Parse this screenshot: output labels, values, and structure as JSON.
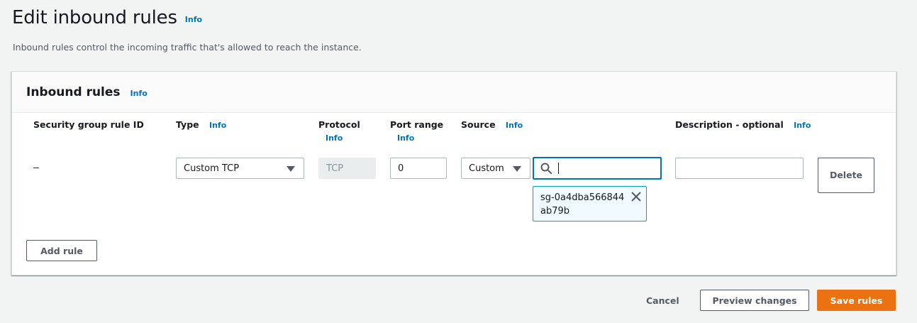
{
  "page": {
    "title": "Edit inbound rules",
    "title_info": "Info",
    "subtitle": "Inbound rules control the incoming traffic that's allowed to reach the instance."
  },
  "panel": {
    "title": "Inbound rules",
    "title_info": "Info",
    "columns": {
      "rule_id": "Security group rule ID",
      "type": "Type",
      "type_info": "Info",
      "protocol": "Protocol",
      "protocol_info": "Info",
      "port_range": "Port range",
      "port_range_info": "Info",
      "source": "Source",
      "source_info": "Info",
      "description": "Description - optional",
      "description_info": "Info"
    },
    "rule": {
      "rule_id": "–",
      "type": "Custom TCP",
      "protocol": "TCP",
      "port_range": "0",
      "source_type": "Custom",
      "source_search": "",
      "source_token": "sg-0a4dba566844ab79b",
      "description": "",
      "delete_label": "Delete"
    },
    "add_rule_label": "Add rule"
  },
  "footer": {
    "cancel_label": "Cancel",
    "preview_label": "Preview changes",
    "save_label": "Save rules"
  },
  "colors": {
    "accent": "#0073bb",
    "primary_button": "#ec7211",
    "token_border": "#00a1c9"
  },
  "icons": {
    "search": "search-icon",
    "close": "close-icon",
    "dropdown": "caret-down-icon"
  }
}
